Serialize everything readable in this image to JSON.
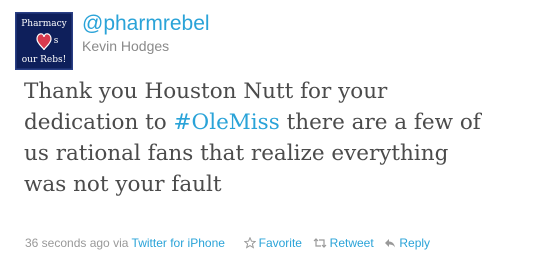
{
  "tweet": {
    "avatar": {
      "text_top": "Pharmacy",
      "text_middle": "s",
      "text_bottom": "our Rebs!"
    },
    "handle": "@pharmrebel",
    "name": "Kevin Hodges",
    "text": {
      "line1": "Thank you Houston Nutt for your",
      "line2_before": "dedication to ",
      "hashtag": "#OleMiss",
      "line2_after": " there are a few of",
      "line3": "us rational fans that realize everything",
      "line4": "was not your fault"
    },
    "meta": {
      "timestamp": "36 seconds ago",
      "via": "via",
      "source": "Twitter for iPhone"
    },
    "actions": {
      "favorite": "Favorite",
      "retweet": "Retweet",
      "reply": "Reply"
    },
    "icons": {
      "favorite": "star-icon",
      "retweet": "retweet-icon",
      "reply": "reply-icon"
    },
    "colors": {
      "link": "#2aa3d8",
      "text": "#4b4b4b",
      "muted": "#999999",
      "avatar_bg": "#0e1f5b",
      "heart": "#d83a4e"
    }
  }
}
